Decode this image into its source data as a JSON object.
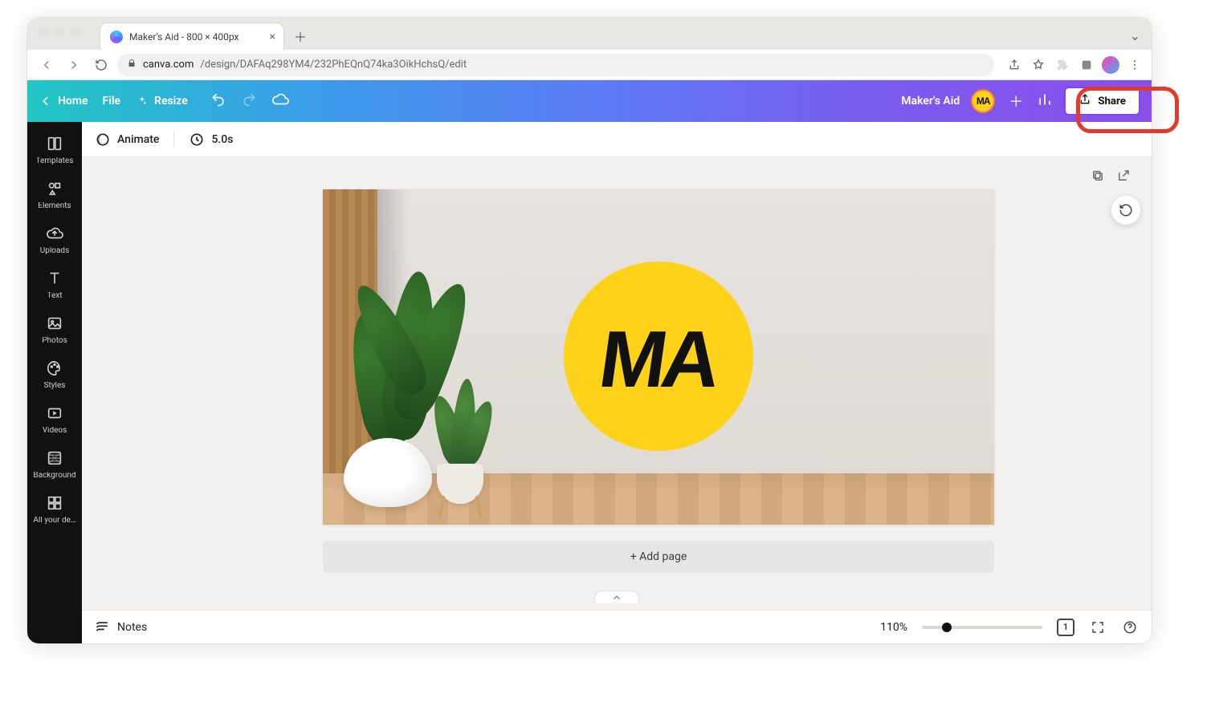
{
  "browser": {
    "tab_title": "Maker's Aid - 800 × 400px",
    "url_host": "canva.com",
    "url_path": "/design/DAFAq298YM4/232PhEQnQ74ka3OikHchsQ/edit"
  },
  "toolbar": {
    "home": "Home",
    "file": "File",
    "resize": "Resize",
    "project_name": "Maker's Aid",
    "avatar_text": "MA",
    "share": "Share"
  },
  "subtoolbar": {
    "animate": "Animate",
    "duration": "5.0s"
  },
  "sidebar": {
    "items": [
      {
        "label": "Templates",
        "icon": "templates"
      },
      {
        "label": "Elements",
        "icon": "elements"
      },
      {
        "label": "Uploads",
        "icon": "uploads"
      },
      {
        "label": "Text",
        "icon": "text"
      },
      {
        "label": "Photos",
        "icon": "photos"
      },
      {
        "label": "Styles",
        "icon": "styles"
      },
      {
        "label": "Videos",
        "icon": "videos"
      },
      {
        "label": "Background",
        "icon": "background"
      },
      {
        "label": "All your de…",
        "icon": "allyourdesigns"
      }
    ]
  },
  "canvas": {
    "logo_text": "MA",
    "add_page": "+ Add page"
  },
  "bottombar": {
    "notes": "Notes",
    "zoom_label": "110%",
    "zoom_value": 110,
    "zoom_min": 10,
    "zoom_max": 500,
    "page_indicator": "1"
  },
  "annotation": {
    "highlight_target": "share-button"
  }
}
